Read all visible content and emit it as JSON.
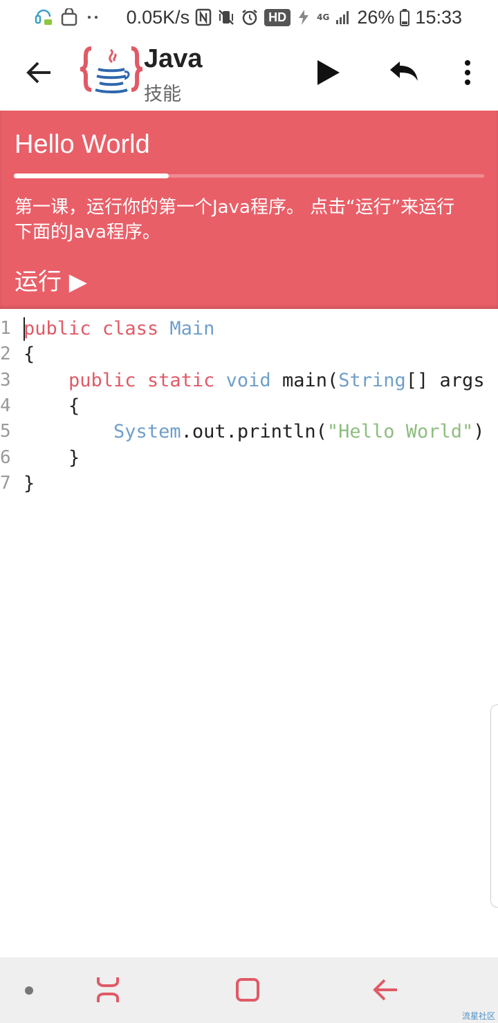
{
  "status_bar": {
    "net_speed": "0.05K/s",
    "hd": "HD",
    "network": "4G",
    "battery": "26%",
    "time": "15:33"
  },
  "app_bar": {
    "title": "Java",
    "subtitle": "技能",
    "icons": {
      "back": "arrow-left-icon",
      "run": "play-icon",
      "undo": "undo-icon",
      "more": "more-vert-icon"
    }
  },
  "lesson": {
    "title": "Hello World",
    "progress_percent": 33,
    "description": "第一课，运行你的第一个Java程序。 点击“运行”来运行下面的Java程序。",
    "run_label": "运行 ▶"
  },
  "editor": {
    "lines": [
      {
        "num": "1",
        "indent": "",
        "tokens": [
          [
            "kw",
            "public"
          ],
          [
            "",
            "&nbsp;"
          ],
          [
            "kw",
            "class"
          ],
          [
            "",
            "&nbsp;"
          ],
          [
            "ty",
            "Main"
          ]
        ]
      },
      {
        "num": "2",
        "indent": "",
        "tokens": [
          [
            "",
            "{"
          ]
        ]
      },
      {
        "num": "3",
        "indent": "    ",
        "tokens": [
          [
            "kw",
            "public"
          ],
          [
            "",
            " "
          ],
          [
            "kw",
            "static"
          ],
          [
            "",
            " "
          ],
          [
            "ty",
            "void"
          ],
          [
            "",
            " main("
          ],
          [
            "ty",
            "String"
          ],
          [
            "",
            "[] args"
          ]
        ]
      },
      {
        "num": "4",
        "indent": "    ",
        "tokens": [
          [
            "",
            "{"
          ]
        ]
      },
      {
        "num": "5",
        "indent": "        ",
        "tokens": [
          [
            "ty",
            "System"
          ],
          [
            "",
            ".out.println("
          ],
          [
            "st",
            "\"Hello World\""
          ],
          [
            "",
            ")"
          ]
        ]
      },
      {
        "num": "6",
        "indent": "    ",
        "tokens": [
          [
            "",
            "}"
          ]
        ]
      },
      {
        "num": "7",
        "indent": "",
        "tokens": [
          [
            "",
            "}"
          ]
        ]
      }
    ]
  },
  "nav_bar": {
    "icons": {
      "recents": "recents-icon",
      "home": "home-icon",
      "back": "back-arrow-icon"
    }
  },
  "colors": {
    "lesson_bg": "#e95f68",
    "keyword": "#e05a66",
    "type": "#6f9ec9",
    "string": "#8ebd7f",
    "nav_accent": "#e05a66"
  },
  "watermark": "流星社区"
}
